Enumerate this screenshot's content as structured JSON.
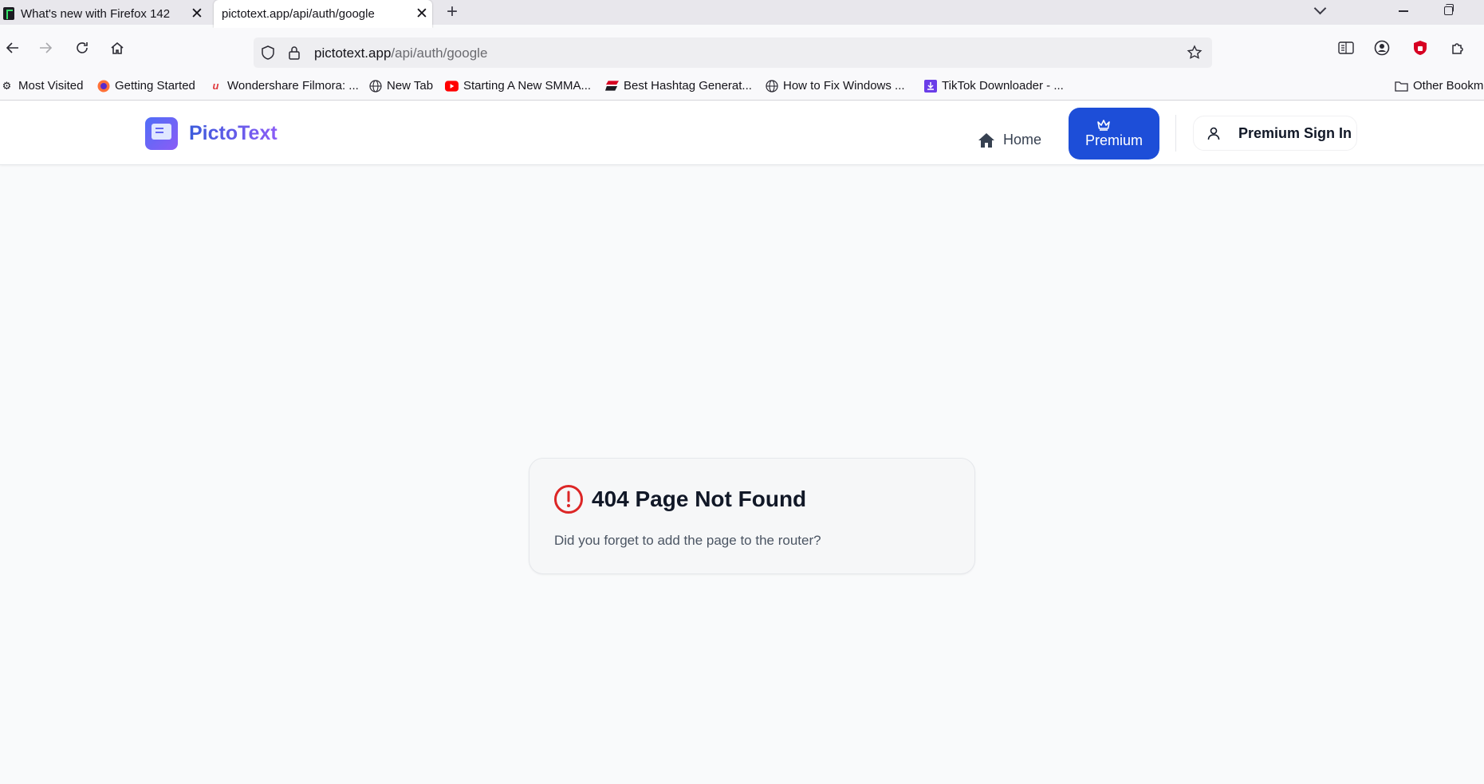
{
  "browser": {
    "tabs": [
      {
        "title": "What's new with Firefox 142",
        "active": false
      },
      {
        "title": "pictotext.app/api/auth/google",
        "active": true
      }
    ],
    "new_tab_symbol": "+",
    "close_symbol": "✕",
    "url": {
      "host": "pictotext.app",
      "path": "/api/auth/google"
    },
    "bookmarks": [
      {
        "label": "Most Visited",
        "icon": "gear-icon"
      },
      {
        "label": "Getting Started",
        "icon": "firefox-icon"
      },
      {
        "label": "Wondershare Filmora: ...",
        "icon": "filmora-icon"
      },
      {
        "label": "New Tab",
        "icon": "globe-icon"
      },
      {
        "label": "Starting A New SMMA...",
        "icon": "youtube-icon"
      },
      {
        "label": "Best Hashtag Generat...",
        "icon": "hashtag-site-icon"
      },
      {
        "label": "How to Fix Windows ...",
        "icon": "globe-icon"
      },
      {
        "label": "TikTok Downloader - ...",
        "icon": "download-icon"
      }
    ],
    "other_bookmarks": "Other Bookm"
  },
  "site": {
    "brand": "PictoText",
    "nav": {
      "home": "Home",
      "premium": "Premium",
      "signin": "Premium Sign In"
    },
    "error": {
      "title": "404 Page Not Found",
      "message": "Did you forget to add the page to the router?"
    }
  },
  "colors": {
    "accent": "#1d4ed8",
    "error": "#dc2626",
    "page_bg": "#f9fafb"
  }
}
